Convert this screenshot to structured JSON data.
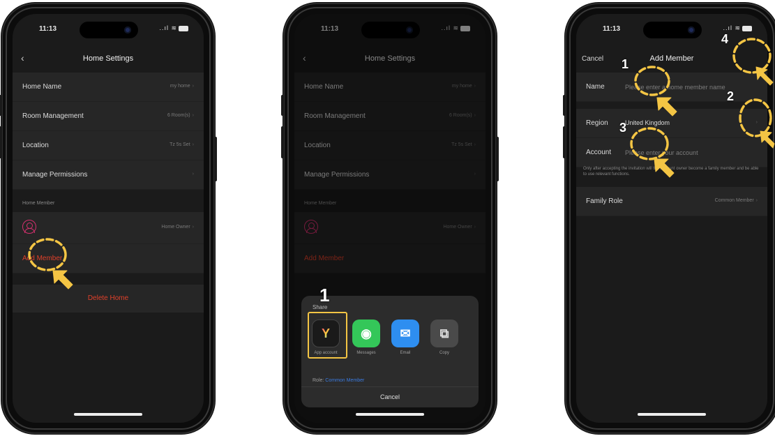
{
  "status": {
    "time_1": "11:13",
    "time_2": "11:13",
    "time_3": "11:13",
    "icons": "..ıl ≋",
    "battery": ""
  },
  "screen1": {
    "title": "Home Settings",
    "rows": [
      {
        "label": "Home Name",
        "value": "my home"
      },
      {
        "label": "Room Management",
        "value": "6 Room(s)"
      },
      {
        "label": "Location",
        "value": "Tz 5s Set"
      },
      {
        "label": "Manage Permissions",
        "value": ""
      }
    ],
    "member_caption": "Home Member",
    "member_role": "Home Owner",
    "add_member": "Add Member",
    "delete_home": "Delete Home"
  },
  "screen2": {
    "title": "Home Settings",
    "rows": [
      {
        "label": "Home Name",
        "value": "my home"
      },
      {
        "label": "Room Management",
        "value": "6 Room(s)"
      },
      {
        "label": "Location",
        "value": "Tz 5s Set"
      },
      {
        "label": "Manage Permissions",
        "value": ""
      }
    ],
    "member_caption": "Home Member",
    "member_role": "Home Owner",
    "add_member": "Add Member",
    "sheet": {
      "title": "Share",
      "apps": [
        {
          "label": "App account",
          "glyph": "Y",
          "color": "#1a1a1a"
        },
        {
          "label": "Messages",
          "glyph": "◉",
          "color": "#34c759"
        },
        {
          "label": "Email",
          "glyph": "✉",
          "color": "#2e8ef0"
        },
        {
          "label": "Copy",
          "glyph": "⧉",
          "color": "#4a4a4a"
        }
      ],
      "role_label": "Role:",
      "role_value": "Common Member",
      "cancel": "Cancel"
    }
  },
  "screen3": {
    "title": "Add Member",
    "cancel": "Cancel",
    "name_label": "Name",
    "name_placeholder": "Please enter a home member name",
    "region_label": "Region",
    "region_value": "United Kingdom",
    "account_label": "Account",
    "account_placeholder": "Please enter your account",
    "note": "Only after accepting the invitation will the account owner become a family member and be able to use relevant functions.",
    "family_role_label": "Family Role",
    "family_role_value": "Common Member"
  },
  "callouts": {
    "s2_one": "1",
    "s3_one": "1",
    "s3_two": "2",
    "s3_three": "3",
    "s3_four": "4"
  },
  "colors": {
    "highlight": "#f4c544",
    "accent_red": "#e0402a",
    "accent_blue": "#3b7be0"
  }
}
